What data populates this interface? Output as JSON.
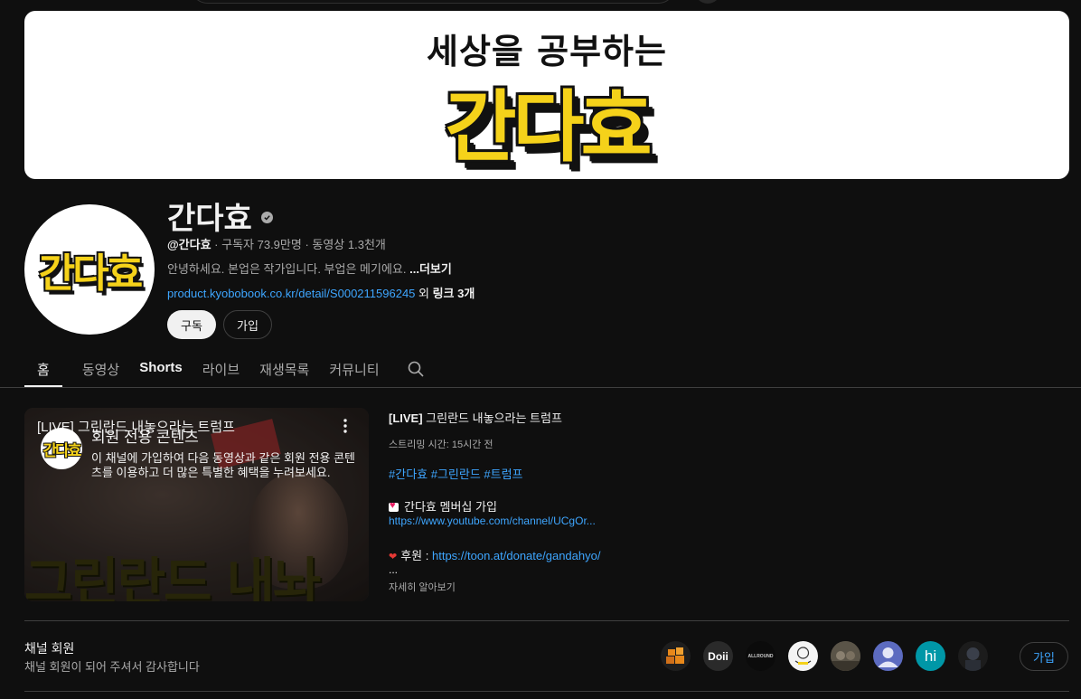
{
  "banner": {
    "subtitle": "세상을 공부하는",
    "title": "간다효"
  },
  "avatar": {
    "text": "간다효"
  },
  "channel": {
    "name": "간다효",
    "handle": "@간다효",
    "stats": " · 구독자 73.9만명 · 동영상 1.3천개",
    "description": "안녕하세요. 본업은 작가입니다. 부업은 메기에요. ",
    "more": "...더보기",
    "link_url": "product.kyobobook.co.kr/detail/S000211596245",
    "link_extra_prefix": " 외 ",
    "link_extra": "링크 3개"
  },
  "buttons": {
    "subscribe": "구독",
    "join": "가입"
  },
  "tabs": {
    "home": "홈",
    "videos": "동영상",
    "shorts": "Shorts",
    "live": "라이브",
    "playlists": "재생목록",
    "community": "커뮤니티"
  },
  "featured": {
    "overlay_title": "[LIVE] 그린란드 내놓으라는 트럼프",
    "logo_text": "간다효",
    "members_title": "회원 전용 콘텐츠",
    "members_desc": "이 채널에 가입하여 다음 동영상과 같은 회원 전용 콘텐츠를 이용하고 더 많은 특별한 혜택을 누려보세요.",
    "thumb_text": "그린란드 내놔",
    "title_tag": "[LIVE]",
    "title_rest": " 그린란드 내놓으라는 트럼프",
    "stream_time": "스트리밍 시간: 15시간 전",
    "hashtags": "#간다효 #그린란드 #트럼프",
    "membership_label": "간다효 멤버십 가입",
    "membership_url": "https://www.youtube.com/channel/UCgOr...",
    "donate_label": "후원 : ",
    "donate_url": "https://toon.at/donate/gandahyo/",
    "ellipsis": "...",
    "learn_more": "자세히 알아보기"
  },
  "members": {
    "title": "채널 회원",
    "subtitle": "채널 회원이 되어 주셔서 감사합니다",
    "join": "가입",
    "avatars": [
      {
        "label": "",
        "bg": "#1e1e1e",
        "fg": "#e8881a"
      },
      {
        "label": "Doii",
        "bg": "#2a2a2a",
        "fg": "#ffffff"
      },
      {
        "label": "ALLROUND",
        "bg": "#0b0b0b",
        "fg": "#cccccc"
      },
      {
        "label": "",
        "bg": "#f4f4f4",
        "fg": "#222222"
      },
      {
        "label": "",
        "bg": "#5a5448",
        "fg": "#ffffff"
      },
      {
        "label": "",
        "bg": "#5c6bc0",
        "fg": "#ffffff"
      },
      {
        "label": "hi",
        "bg": "#0097a7",
        "fg": "#ffffff"
      },
      {
        "label": "",
        "bg": "#1c1c1c",
        "fg": "#ffffff"
      }
    ]
  }
}
